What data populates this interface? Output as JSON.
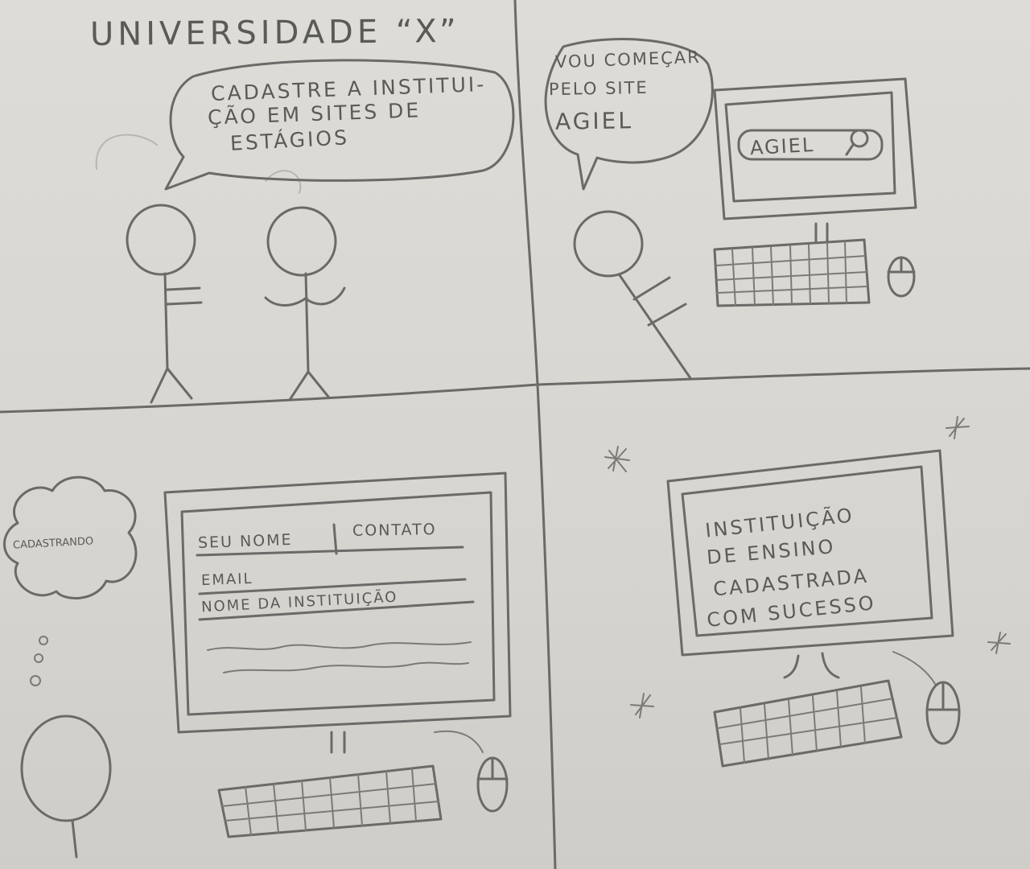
{
  "title": "UNIVERSIDADE “X”",
  "panels": [
    {
      "id": 1,
      "speech": [
        "CADASTRE A INSTITUI-",
        "ÇÃO EM SITES DE",
        "ESTÁGIOS"
      ]
    },
    {
      "id": 2,
      "speech": [
        "VOU COMEÇAR",
        "PELO SITE",
        "AGIEL"
      ],
      "screen_label": "AGIEL"
    },
    {
      "id": 3,
      "thought": "CADASTRANDO",
      "form": {
        "name_field": "SEU NOME",
        "contact_field": "CONTATO",
        "email_field": "EMAIL",
        "institution_field": "NOME DA INSTITUIÇÃO"
      }
    },
    {
      "id": 4,
      "screen_message": [
        "INSTITUIÇÃO",
        "DE ENSINO",
        "CADASTRADA",
        "COM SUCESSO"
      ]
    }
  ],
  "colors": {
    "paper": "#dedcd6",
    "pencil": "#6a6a68"
  }
}
